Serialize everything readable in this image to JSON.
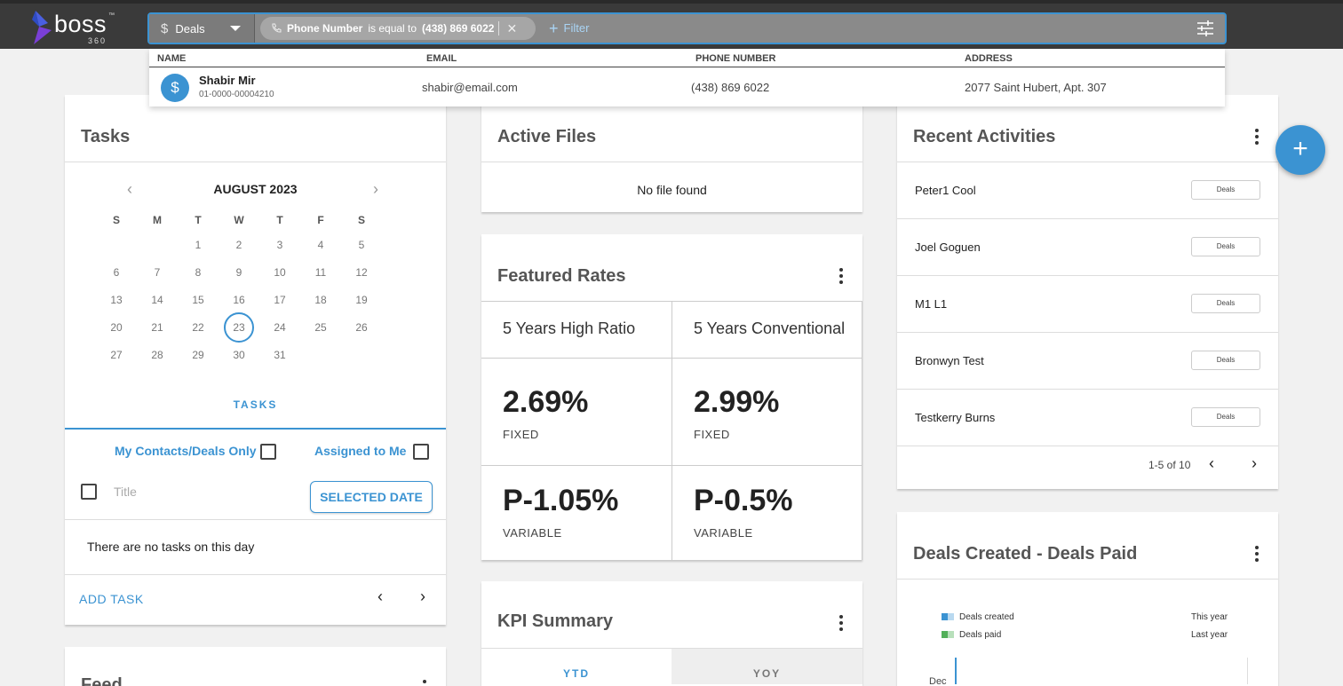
{
  "app": {
    "logo_text": "boss",
    "logo_sub": "360",
    "logo_tm": "™"
  },
  "search": {
    "entity": "Deals",
    "filter_field": "Phone Number",
    "filter_operator": "is equal to",
    "filter_value": "(438) 869 6022",
    "add_filter_label": "Filter"
  },
  "results": {
    "columns": [
      "NAME",
      "EMAIL",
      "PHONE NUMBER",
      "ADDRESS"
    ],
    "rows": [
      {
        "name": "Shabir Mir",
        "id": "01-0000-00004210",
        "email": "shabir@email.com",
        "phone": "(438) 869 6022",
        "address": "2077 Saint Hubert, Apt. 307"
      }
    ]
  },
  "tasks": {
    "title": "Tasks",
    "month": "AUGUST 2023",
    "weekdays": [
      "S",
      "M",
      "T",
      "W",
      "T",
      "F",
      "S"
    ],
    "today": 23,
    "tab_label": "TASKS",
    "my_contacts_label": "My Contacts/Deals Only",
    "assigned_label": "Assigned to Me",
    "title_placeholder": "Title",
    "selected_date_label": "SELECTED DATE",
    "empty_text": "There are no tasks on this day",
    "add_task_label": "ADD TASK"
  },
  "feed": {
    "title": "Feed"
  },
  "active_files": {
    "title": "Active Files",
    "empty_text": "No file found"
  },
  "featured_rates": {
    "title": "Featured Rates",
    "columns": [
      {
        "head": "5 Years High Ratio",
        "fixed": "2.69%",
        "fixed_label": "FIXED",
        "variable": "P-1.05%",
        "variable_label": "VARIABLE"
      },
      {
        "head": "5 Years Conventional",
        "fixed": "2.99%",
        "fixed_label": "FIXED",
        "variable": "P-0.5%",
        "variable_label": "VARIABLE"
      }
    ]
  },
  "kpi": {
    "title": "KPI Summary",
    "tabs": [
      "YTD",
      "YOY"
    ]
  },
  "recent_activities": {
    "title": "Recent Activities",
    "items": [
      {
        "name": "Peter1 Cool",
        "badge": "Deals"
      },
      {
        "name": "Joel Goguen",
        "badge": "Deals"
      },
      {
        "name": "M1 L1",
        "badge": "Deals"
      },
      {
        "name": "Bronwyn Test",
        "badge": "Deals"
      },
      {
        "name": "Testkerry Burns",
        "badge": "Deals"
      }
    ],
    "pager_text": "1-5 of 10"
  },
  "deals_chart": {
    "title": "Deals Created - Deals Paid",
    "legend": [
      "Deals created",
      "Deals paid"
    ],
    "legend_right": [
      "This year",
      "Last year"
    ],
    "first_category": "Dec"
  },
  "colors": {
    "accent": "#3b93d2",
    "topbar": "#3a3a3a",
    "deals_paid": "#52b05a"
  },
  "icons": {
    "fab": "plus-icon",
    "tune": "tune-icon",
    "phone": "phone-icon"
  }
}
